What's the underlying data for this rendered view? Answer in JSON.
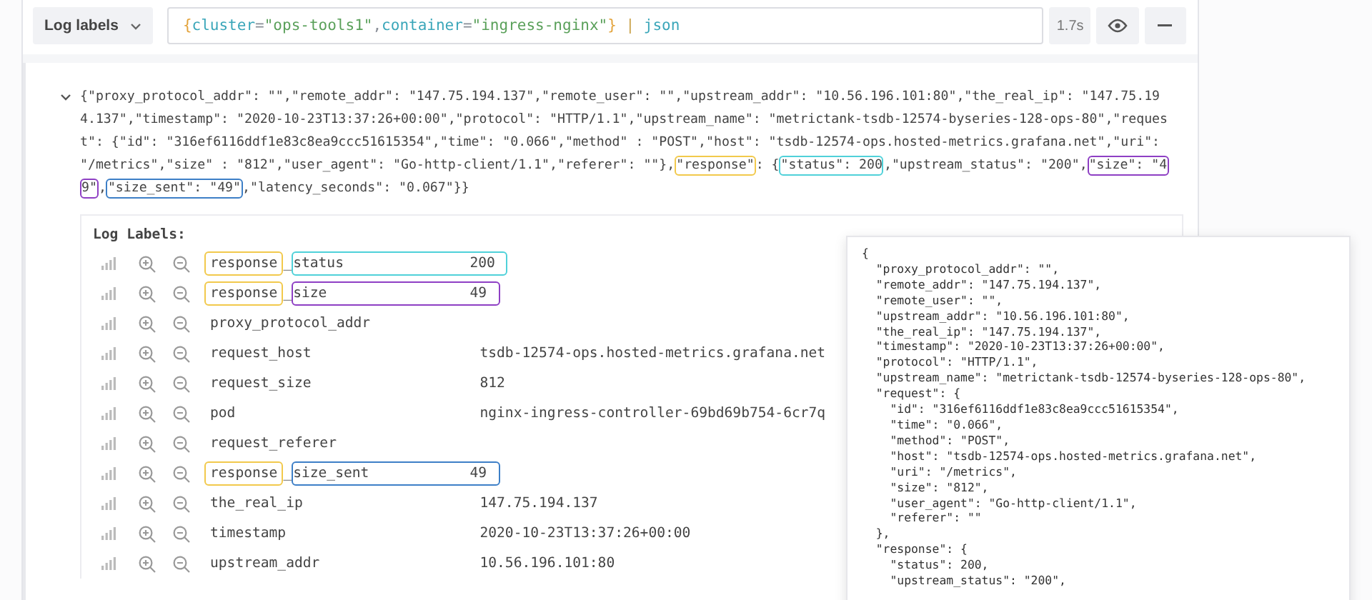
{
  "query_bar": {
    "label_button": "Log labels",
    "query": [
      {
        "text": "{",
        "kind": "brace"
      },
      {
        "text": "cluster",
        "kind": "label"
      },
      {
        "text": "=",
        "kind": "op"
      },
      {
        "text": "\"ops-tools1\"",
        "kind": "string"
      },
      {
        "text": ",",
        "kind": "op"
      },
      {
        "text": "container",
        "kind": "label"
      },
      {
        "text": "=",
        "kind": "op"
      },
      {
        "text": "\"ingress-nginx\"",
        "kind": "string"
      },
      {
        "text": "}",
        "kind": "brace"
      },
      {
        "text": " | ",
        "kind": "pipe"
      },
      {
        "text": "json",
        "kind": "keyword"
      }
    ],
    "duration": "1.7s"
  },
  "log_line": {
    "expanded": true,
    "lines": [
      [
        {
          "text": "{\"proxy_protocol_addr\": \"\",\"remote_addr\": \"147.75.194.137\",\"remote_user\": \"\",\"upstream_addr\": \"10.56.196.101:80\",\"the_real_ip\": \"147.75.19"
        }
      ],
      [
        {
          "text": "4.137\",\"timestamp\": \"2020-10-23T13:37:26+00:00\",\"protocol\": \"HTTP/1.1\",\"upstream_name\": \"metrictank-tsdb-12574-byseries-128-ops-80\",\"reques"
        }
      ],
      [
        {
          "text": "t\": {\"id\": \"316ef6116ddf1e83c8ea9ccc51615354\",\"time\": \"0.066\",\"method\" : \"POST\",\"host\": \"tsdb-12574-ops.hosted-metrics.grafana.net\",\"uri\":"
        }
      ],
      [
        {
          "text": "\"/metrics\",\"size\" : \"812\",\"user_agent\": \"Go-http-client/1.1\",\"referer\": \"\"},"
        },
        {
          "text": "\"response\"",
          "color": "#f2c94c"
        },
        {
          "text": ": {"
        },
        {
          "text": "\"status\": 200",
          "color": "#4fd1d9"
        },
        {
          "text": ",\"upstream_status\": \"200\","
        },
        {
          "text": "\"size\": \"4",
          "color": "#8e3fc4"
        }
      ],
      [
        {
          "text": "9\"",
          "color": "#8e3fc4"
        },
        {
          "text": ","
        },
        {
          "text": "\"size_sent\": \"49\"",
          "color": "#3d7fc7"
        },
        {
          "text": ",\"latency_seconds\": \"0.067\"}}"
        }
      ]
    ]
  },
  "log_labels": {
    "title": "Log Labels:",
    "rows": [
      {
        "prefix": {
          "text": "response",
          "color": "#f2c94c"
        },
        "sep": "_",
        "key": "status",
        "value": "200",
        "color": "#4fd1d9"
      },
      {
        "prefix": {
          "text": "response",
          "color": "#f2c94c"
        },
        "sep": "_",
        "key": "size",
        "value": "49",
        "color": "#8e3fc4"
      },
      {
        "key": "proxy_protocol_addr"
      },
      {
        "key": "request_host",
        "value": "tsdb-12574-ops.hosted-metrics.grafana.net"
      },
      {
        "key": "request_size",
        "value": "812"
      },
      {
        "key": "pod",
        "value": "nginx-ingress-controller-69bd69b754-6cr7q"
      },
      {
        "key": "request_referer"
      },
      {
        "prefix": {
          "text": "response",
          "color": "#f2c94c"
        },
        "sep": "_",
        "key": "size_sent",
        "value": "49",
        "color": "#3d7fc7"
      },
      {
        "key": "the_real_ip",
        "value": "147.75.194.137"
      },
      {
        "key": "timestamp",
        "value": "2020-10-23T13:37:26+00:00"
      },
      {
        "key": "upstream_addr",
        "value": "10.56.196.101:80"
      }
    ]
  },
  "json_popover": {
    "lines": [
      "{",
      "  \"proxy_protocol_addr\": \"\",",
      "  \"remote_addr\": \"147.75.194.137\",",
      "  \"remote_user\": \"\",",
      "  \"upstream_addr\": \"10.56.196.101:80\",",
      "  \"the_real_ip\": \"147.75.194.137\",",
      "  \"timestamp\": \"2020-10-23T13:37:26+00:00\",",
      "  \"protocol\": \"HTTP/1.1\",",
      "  \"upstream_name\": \"metrictank-tsdb-12574-byseries-128-ops-80\",",
      "  \"request\": {",
      "    \"id\": \"316ef6116ddf1e83c8ea9ccc51615354\",",
      "    \"time\": \"0.066\",",
      "    \"method\": \"POST\",",
      "    \"host\": \"tsdb-12574-ops.hosted-metrics.grafana.net\",",
      "    \"uri\": \"/metrics\",",
      "    \"size\": \"812\",",
      "    \"user_agent\": \"Go-http-client/1.1\",",
      "    \"referer\": \"\"",
      "  },",
      "  \"response\": {",
      "    \"status\": 200,",
      "    \"upstream_status\": \"200\","
    ]
  }
}
